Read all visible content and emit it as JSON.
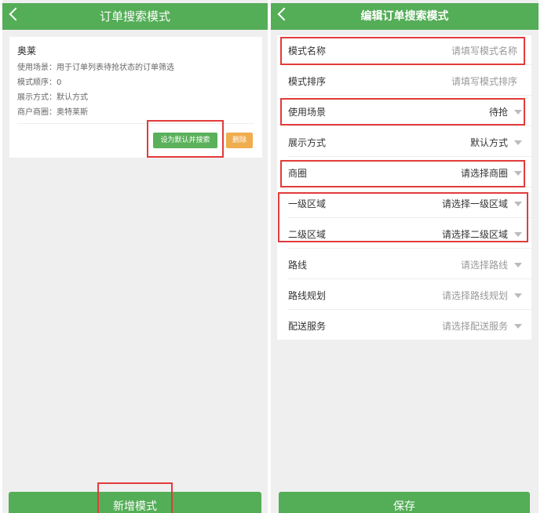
{
  "left": {
    "header": {
      "title": "订单搜索模式"
    },
    "card": {
      "name": "奥莱",
      "lines": [
        "使用场景：用于订单列表待抢状态的订单筛选",
        "模式顺序：0",
        "展示方式：默认方式",
        "商户商圈：奥特莱斯"
      ],
      "set_default_label": "设为默认并搜索",
      "delete_label": "删除"
    },
    "bottom_button_label": "新增模式"
  },
  "right": {
    "header": {
      "title": "编辑订单搜索模式"
    },
    "fields": [
      {
        "label": "模式名称",
        "value": "请填写模式名称",
        "placeholder": true,
        "dropdown": false
      },
      {
        "label": "模式排序",
        "value": "请填写模式排序",
        "placeholder": true,
        "dropdown": false
      },
      {
        "label": "使用场景",
        "value": "待抢",
        "placeholder": false,
        "dropdown": true
      },
      {
        "label": "展示方式",
        "value": "默认方式",
        "placeholder": false,
        "dropdown": true
      },
      {
        "label": "商圈",
        "value": "请选择商圈",
        "placeholder": false,
        "dropdown": true
      },
      {
        "label": "一级区域",
        "value": "请选择一级区域",
        "placeholder": false,
        "dropdown": true
      },
      {
        "label": "二级区域",
        "value": "请选择二级区域",
        "placeholder": false,
        "dropdown": true
      },
      {
        "label": "路线",
        "value": "请选择路线",
        "placeholder": true,
        "dropdown": true
      },
      {
        "label": "路线规划",
        "value": "请选择路线规划",
        "placeholder": true,
        "dropdown": true
      },
      {
        "label": "配送服务",
        "value": "请选择配送服务",
        "placeholder": true,
        "dropdown": true
      }
    ],
    "save_label": "保存"
  },
  "colors": {
    "brand_green": "#54ad57",
    "button_green": "#5bb15b",
    "delete_orange": "#f0ad4e",
    "highlight_red": "#e23b3b"
  }
}
